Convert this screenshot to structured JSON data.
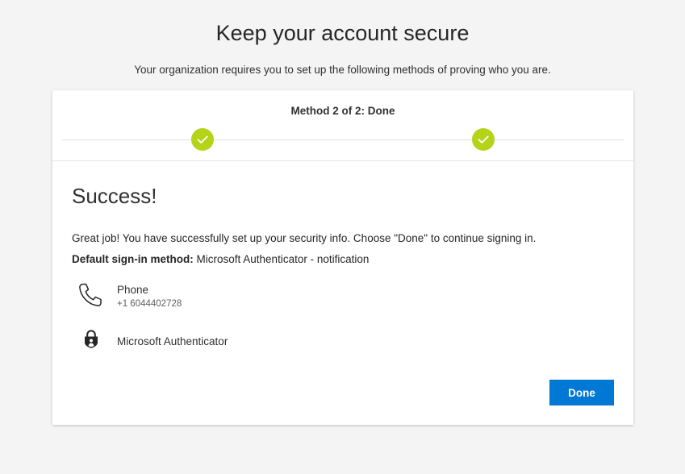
{
  "page": {
    "title": "Keep your account secure",
    "subtitle": "Your organization requires you to set up the following methods of proving who you are."
  },
  "progress": {
    "label": "Method 2 of 2: Done",
    "steps_completed": 2,
    "steps_total": 2,
    "check_color": "#b4d319"
  },
  "success": {
    "title": "Success!",
    "message": "Great job! You have successfully set up your security info. Choose \"Done\" to continue signing in.",
    "default_label": "Default sign-in method:",
    "default_value": "Microsoft Authenticator - notification"
  },
  "methods": [
    {
      "icon": "phone-icon",
      "name": "Phone",
      "detail": "+1 6044402728"
    },
    {
      "icon": "lock-icon",
      "name": "Microsoft Authenticator"
    }
  ],
  "actions": {
    "done_label": "Done",
    "done_color": "#0078d4"
  }
}
